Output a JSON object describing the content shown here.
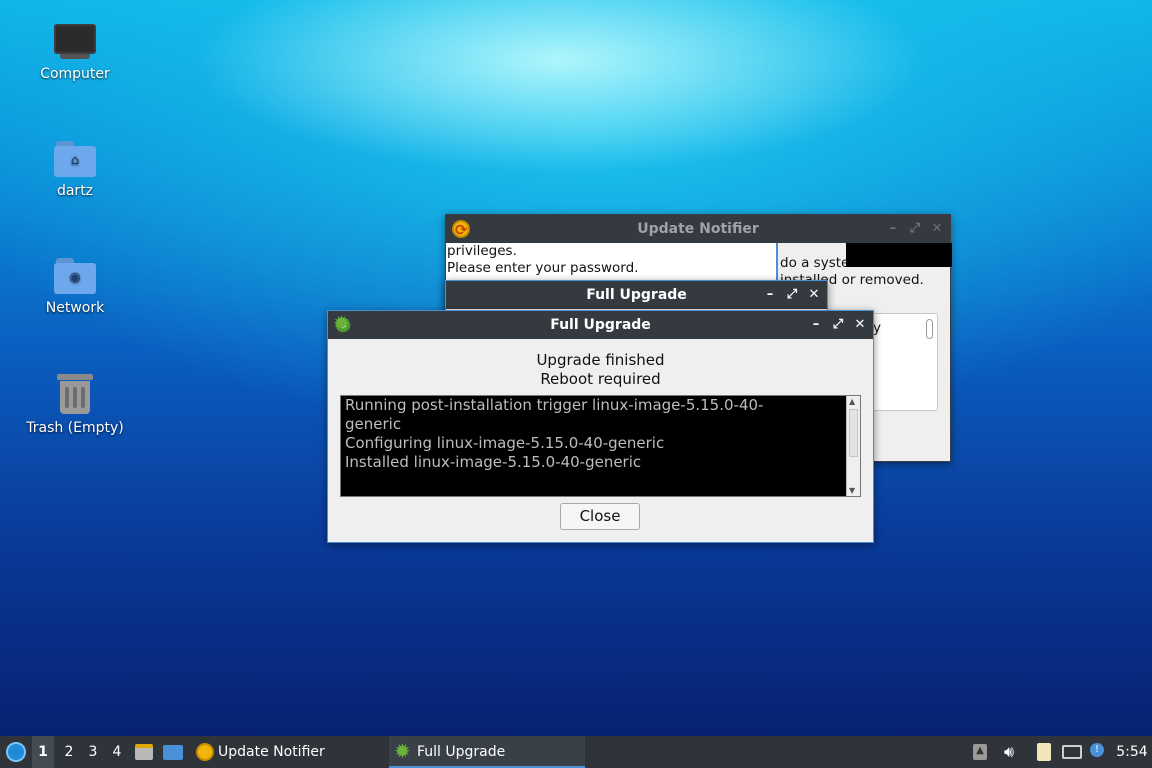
{
  "desktop": {
    "icons": [
      {
        "label": "Computer"
      },
      {
        "label": "dartz"
      },
      {
        "label": "Network"
      },
      {
        "label": "Trash (Empty)"
      }
    ]
  },
  "update_notifier": {
    "title": "Update Notifier",
    "text_line1": "privileges.",
    "text_line2": "Please enter your password.",
    "right_line1": "do a syste",
    "right_line2": "installed or removed.",
    "list_partial": "y"
  },
  "full_upgrade_back": {
    "title": "Full Upgrade"
  },
  "full_upgrade": {
    "title": "Full Upgrade",
    "status_line1": "Upgrade finished",
    "status_line2": "Reboot required",
    "log_lines": [
      "Running post-installation trigger linux-image-5.15.0-40-",
      "generic",
      "Configuring linux-image-5.15.0-40-generic",
      "Installed linux-image-5.15.0-40-generic"
    ],
    "close_label": "Close"
  },
  "window_controls": {
    "minimize": "–",
    "maximize": "⤢",
    "close": "✕"
  },
  "taskbar": {
    "workspaces": [
      "1",
      "2",
      "3",
      "4"
    ],
    "tasks": [
      {
        "label": "Update Notifier"
      },
      {
        "label": "Full Upgrade"
      }
    ],
    "clock": "5:54"
  },
  "colors": {
    "title_bar": "#353a41",
    "taskbar": "#2f343a",
    "active_task_underline": "#4a90d9",
    "active_window_border": "#4a90d9",
    "terminal_bg": "#000000",
    "terminal_text": "#bdbdbd"
  }
}
